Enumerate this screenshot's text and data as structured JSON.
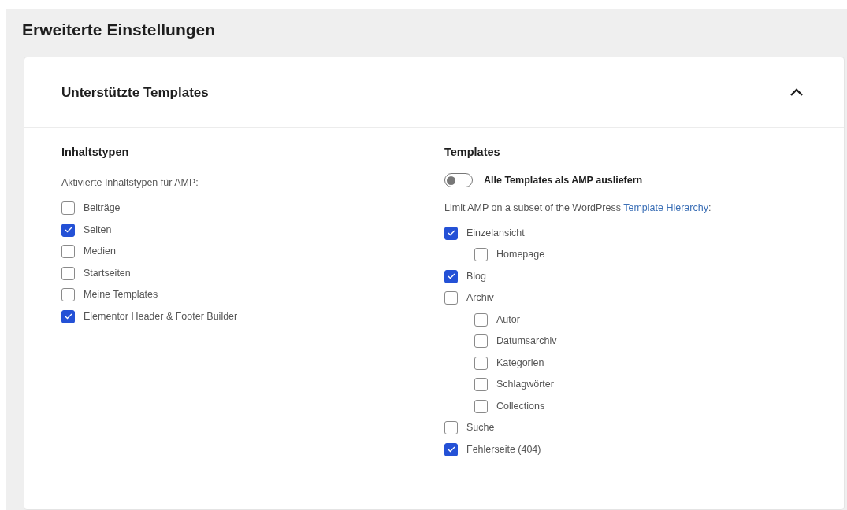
{
  "page_title": "Erweiterte Einstellungen",
  "section": {
    "title": "Unterstützte Templates",
    "expanded": true
  },
  "content_types": {
    "heading": "Inhaltstypen",
    "description": "Aktivierte Inhaltstypen für AMP:",
    "items": [
      {
        "label": "Beiträge",
        "checked": false
      },
      {
        "label": "Seiten",
        "checked": true
      },
      {
        "label": "Medien",
        "checked": false
      },
      {
        "label": "Startseiten",
        "checked": false
      },
      {
        "label": "Meine Templates",
        "checked": false
      },
      {
        "label": "Elementor Header & Footer Builder",
        "checked": true
      }
    ]
  },
  "templates": {
    "heading": "Templates",
    "toggle": {
      "label": "Alle Templates als AMP ausliefern",
      "on": false
    },
    "description": "Limit AMP on a subset of the WordPress ",
    "link": "Template Hierarchy",
    "description_end": ":",
    "items": [
      {
        "label": "Einzelansicht",
        "checked": true,
        "children": [
          {
            "label": "Homepage",
            "checked": false
          }
        ]
      },
      {
        "label": "Blog",
        "checked": true
      },
      {
        "label": "Archiv",
        "checked": false,
        "children": [
          {
            "label": "Autor",
            "checked": false
          },
          {
            "label": "Datumsarchiv",
            "checked": false
          },
          {
            "label": "Kategorien",
            "checked": false
          },
          {
            "label": "Schlagwörter",
            "checked": false
          },
          {
            "label": "Collections",
            "checked": false
          }
        ]
      },
      {
        "label": "Suche",
        "checked": false
      },
      {
        "label": "Fehlerseite (404)",
        "checked": true
      }
    ]
  }
}
